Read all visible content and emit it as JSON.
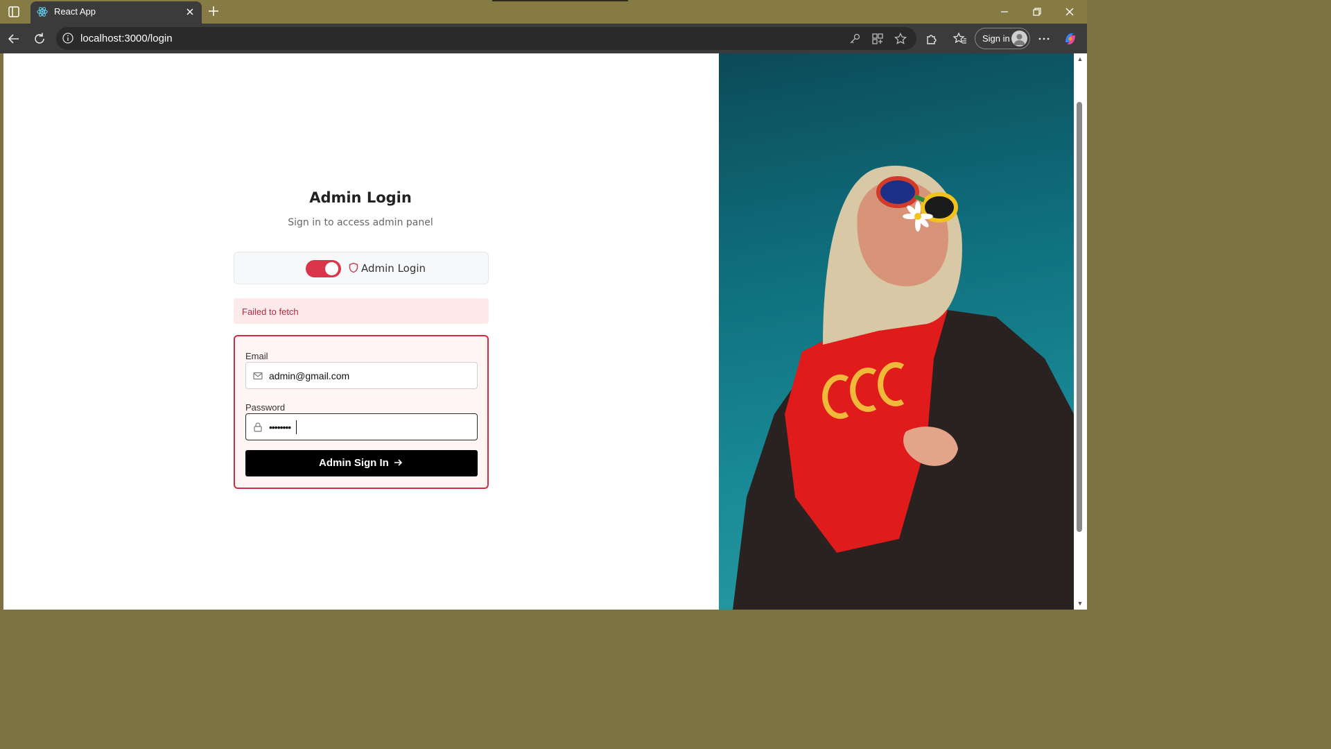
{
  "browser": {
    "tab_title": "React App",
    "url": "localhost:3000/login",
    "signin_label": "Sign in"
  },
  "login": {
    "title": "Admin Login",
    "subtitle": "Sign in to access admin panel",
    "toggle_label": "Admin Login",
    "toggle_on": true,
    "error_message": "Failed to fetch",
    "email_label": "Email",
    "email_value": "admin@gmail.com",
    "password_label": "Password",
    "password_value": "••••••••",
    "submit_label": "Admin Sign In"
  },
  "colors": {
    "accent": "#d9364c",
    "error_bg": "#fde8ea",
    "error_text": "#b32a3e",
    "button_bg": "#000000",
    "tabbar_bg": "#867a45"
  },
  "icons": [
    "sidebar-icon",
    "react-icon",
    "close-icon",
    "plus-icon",
    "minimize-icon",
    "restore-icon",
    "window-close-icon",
    "back-icon",
    "refresh-icon",
    "info-icon",
    "key-icon",
    "apps-icon",
    "star-icon",
    "extensions-icon",
    "favorites-icon",
    "avatar-icon",
    "more-icon",
    "copilot-icon",
    "shield-icon",
    "mail-icon",
    "lock-icon",
    "arrow-right-icon"
  ]
}
